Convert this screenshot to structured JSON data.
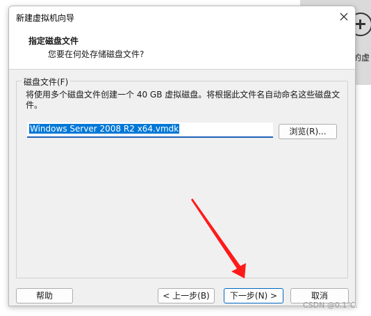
{
  "background": {
    "icon": "plus-circle-icon",
    "partial_text": "的虚"
  },
  "dialog": {
    "title": "新建虚拟机向导",
    "close_icon": "close-icon",
    "header": {
      "title": "指定磁盘文件",
      "subtitle": "您要在何处存储磁盘文件?"
    },
    "group": {
      "legend": "磁盘文件(F)",
      "description": "将使用多个磁盘文件创建一个 40 GB 虚拟磁盘。将根据此文件名自动命名这些磁盘文件。",
      "file_value": "Windows Server 2008 R2 x64.vmdk",
      "browse_label": "浏览(R)..."
    },
    "buttons": {
      "help": "帮助",
      "back": "< 上一步(B)",
      "next": "下一步(N) >",
      "cancel": "取消"
    }
  },
  "annotation": {
    "arrow_color": "#ff1a1a"
  },
  "watermark": "CSDN @0.1℃."
}
